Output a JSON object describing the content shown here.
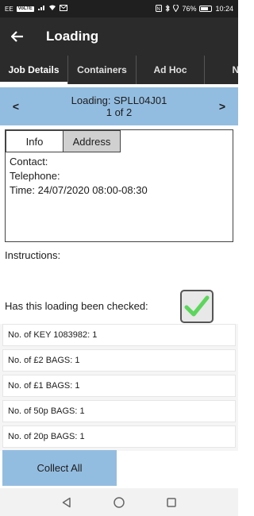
{
  "status_bar": {
    "carrier": "EE",
    "carrier_chip": "VoLTE",
    "battery_percent": "76%",
    "battery_level": 0.76,
    "time": "10:24",
    "icons": [
      "wifi-icon",
      "mail-icon",
      "nfc-icon",
      "bluetooth-icon",
      "location-icon"
    ]
  },
  "app_bar": {
    "title": "Loading",
    "back_icon": "arrow-left-icon"
  },
  "tabs": [
    {
      "label": "Job Details",
      "active": true
    },
    {
      "label": "Containers",
      "active": false
    },
    {
      "label": "Ad Hoc",
      "active": false
    },
    {
      "label": "No",
      "active": false
    }
  ],
  "navigator": {
    "prev_symbol": "<",
    "next_symbol": ">",
    "title": "Loading: SPLL04J01",
    "position": "1 of 2"
  },
  "info_panel": {
    "tabs": [
      {
        "label": "Info",
        "selected": false
      },
      {
        "label": "Address",
        "selected": true
      }
    ],
    "contact": "Contact:",
    "telephone": "Telephone:",
    "time": "Time: 24/07/2020 08:00-08:30"
  },
  "instructions_label": "Instructions:",
  "check": {
    "question": "Has this loading been checked:",
    "checked": true,
    "check_color": "#5cd65c"
  },
  "items": [
    {
      "label": "No. of KEY 1083982: 1"
    },
    {
      "label": "No. of £2 BAGS: 1"
    },
    {
      "label": "No. of £1 BAGS: 1"
    },
    {
      "label": "No. of 50p BAGS: 1"
    },
    {
      "label": "No. of 20p BAGS: 1"
    }
  ],
  "collect_button": "Collect All",
  "colors": {
    "accent": "#93bde0",
    "app_bar": "#2b2b2b"
  },
  "system_nav": [
    "back-triangle-icon",
    "home-circle-icon",
    "recents-square-icon"
  ]
}
